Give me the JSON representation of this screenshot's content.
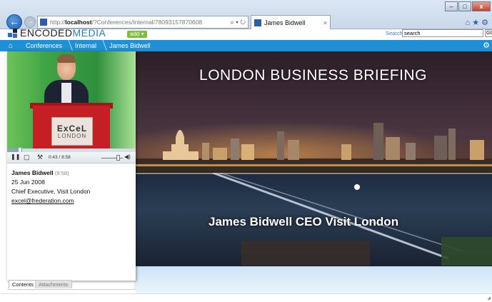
{
  "browser": {
    "url_prefix": "http://",
    "url_host": "localhost",
    "url_path": "/?Conferences/Internal/78093157870608",
    "addr_icons": "⌕ ▾ ↻",
    "tab_title": "James Bidwell",
    "tab_close": "×",
    "window_buttons": [
      "–",
      "□",
      "x"
    ],
    "toolbar_icons": "⌂★⚙",
    "back_glyph": "←",
    "forward_glyph": "→"
  },
  "header": {
    "logo_encoded": "ENCODED",
    "logo_media": "MEDIA",
    "add_label": "add ▾",
    "search_label": "Search",
    "search_value": "search",
    "go_label": "GO"
  },
  "breadcrumb": {
    "home_glyph": "⌂",
    "items": [
      "Conferences",
      "Internal",
      "James Bidwell"
    ],
    "gear_glyph": "⚙"
  },
  "slide": {
    "title": "LONDON BUSINESS BRIEFING",
    "subtitle": "James Bidwell CEO Visit London"
  },
  "video": {
    "lectern_line1": "ExCeL",
    "lectern_line2": "LONDON",
    "progress": 0.1,
    "time": "0:43 / 8:58",
    "volume": 0.75,
    "pause_glyph": "❚❚",
    "captions_glyph": "▢",
    "tools_glyph": "⚒",
    "volume_glyph": "◀)"
  },
  "speaker": {
    "name": "James Bidwell",
    "duration": "(8:58)",
    "date": "25 Jun 2008",
    "role": "Chief Executive, Visit London",
    "email": "excel@frederation.com"
  },
  "panel_tabs": [
    "Contents",
    "Attachments"
  ],
  "colors": {
    "accent_blue": "#1f8fd6",
    "add_green": "#7cbf3a"
  }
}
